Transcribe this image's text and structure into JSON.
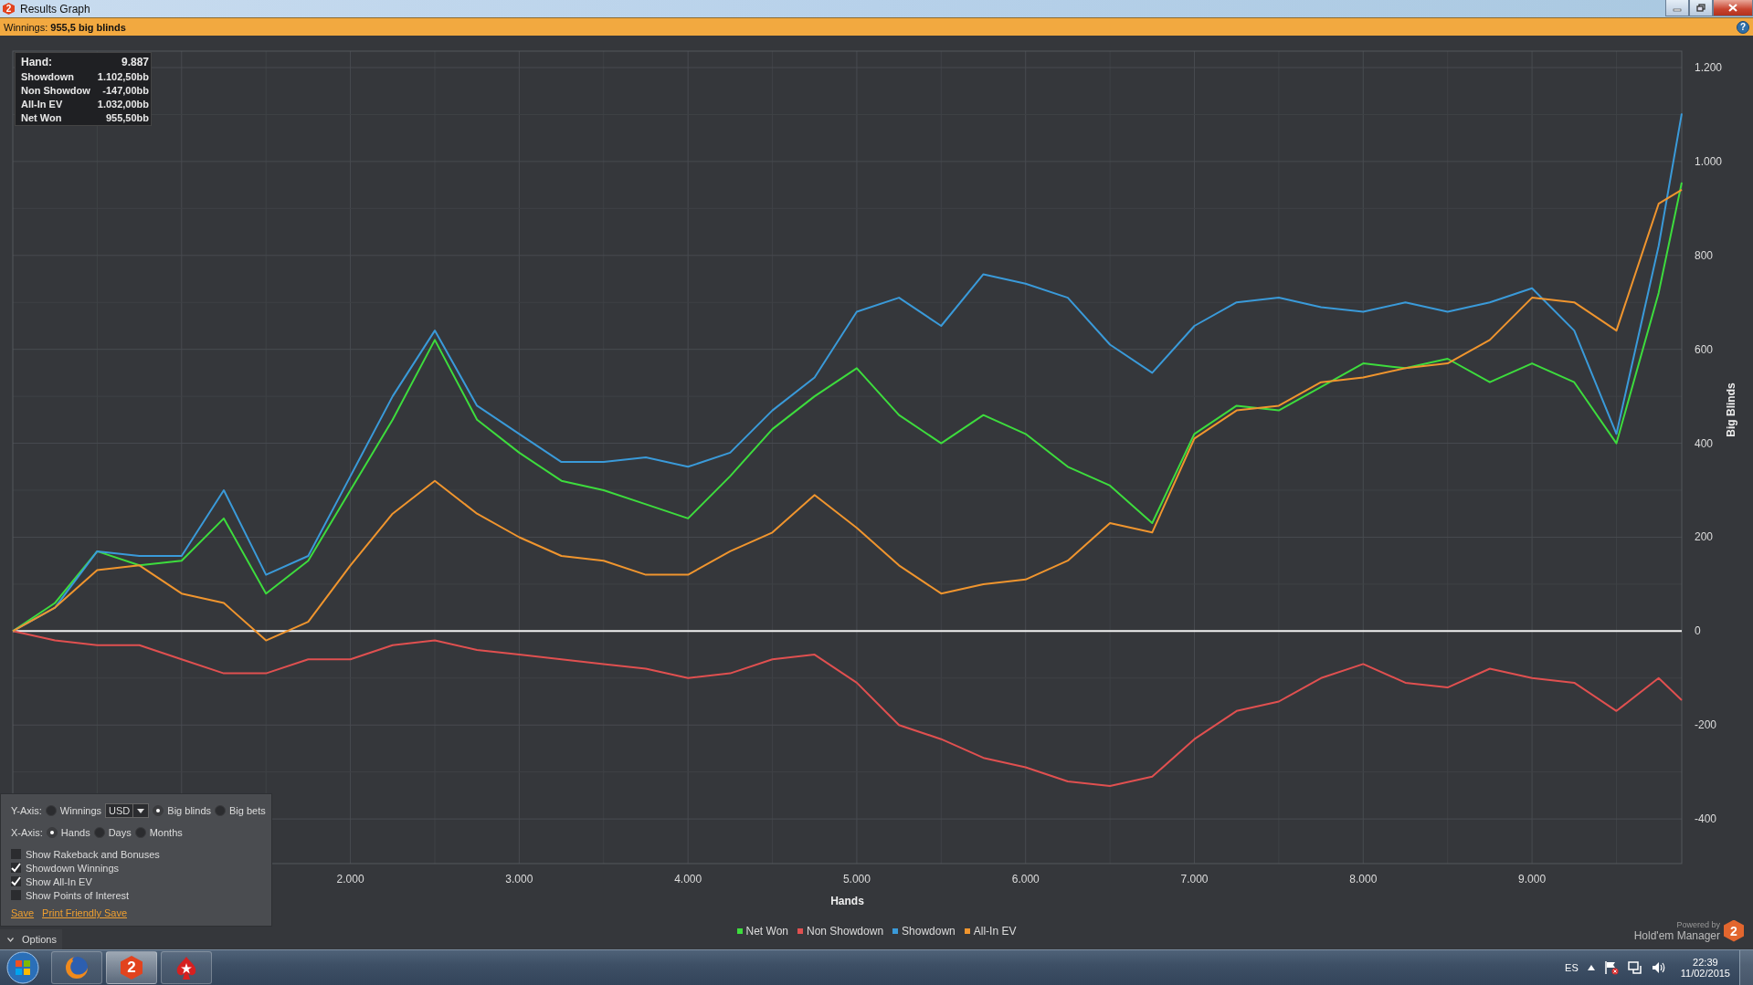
{
  "window": {
    "title": "Results Graph",
    "logo": "2"
  },
  "summary_bar": {
    "text": "Winnings: **955,5 big blinds**",
    "help": "?"
  },
  "stats_box": [
    {
      "label": "Hand:",
      "value": "9.887"
    },
    {
      "label": "Showdown",
      "value": "1.102,50bb"
    },
    {
      "label": "Non Showdow",
      "value": "-147,00bb"
    },
    {
      "label": "All-In EV",
      "value": "1.032,00bb"
    },
    {
      "label": "Net Won",
      "value": "955,50bb"
    }
  ],
  "chart_data": {
    "type": "line",
    "grid": true,
    "xlabel": "Hands",
    "ylabel": "Big Blinds",
    "xlim": [
      0,
      9887
    ],
    "ylim": [
      -495,
      1235
    ],
    "x": [
      0,
      250,
      500,
      750,
      1000,
      1250,
      1500,
      1750,
      2000,
      2250,
      2500,
      2750,
      3000,
      3250,
      3500,
      3750,
      4000,
      4250,
      4500,
      4750,
      5000,
      5250,
      5500,
      5750,
      6000,
      6250,
      6500,
      6750,
      7000,
      7250,
      7500,
      7750,
      8000,
      8250,
      8500,
      8750,
      9000,
      9250,
      9500,
      9750,
      9887
    ],
    "xticks": [
      {
        "value": 2000,
        "label": "2.000"
      },
      {
        "value": 3000,
        "label": "3.000"
      },
      {
        "value": 4000,
        "label": "4.000"
      },
      {
        "value": 5000,
        "label": "5.000"
      },
      {
        "value": 6000,
        "label": "6.000"
      },
      {
        "value": 7000,
        "label": "7.000"
      },
      {
        "value": 8000,
        "label": "8.000"
      },
      {
        "value": 9000,
        "label": "9.000"
      }
    ],
    "yticks": [
      {
        "value": -400,
        "label": "-400"
      },
      {
        "value": -200,
        "label": "-200"
      },
      {
        "value": 0,
        "label": "0"
      },
      {
        "value": 200,
        "label": "200"
      },
      {
        "value": 400,
        "label": "400"
      },
      {
        "value": 600,
        "label": "600"
      },
      {
        "value": 800,
        "label": "800"
      },
      {
        "value": 1000,
        "label": "1.000"
      },
      {
        "value": 1200,
        "label": "1.200"
      }
    ],
    "series": [
      {
        "name": "Net Won",
        "color": "#3ddc3d",
        "values": [
          0,
          60,
          170,
          140,
          150,
          240,
          80,
          150,
          300,
          450,
          620,
          450,
          380,
          320,
          300,
          270,
          240,
          330,
          430,
          500,
          560,
          460,
          400,
          460,
          420,
          350,
          310,
          230,
          420,
          480,
          470,
          520,
          570,
          560,
          580,
          530,
          570,
          530,
          400,
          720,
          955
        ]
      },
      {
        "name": "Non Showdown",
        "color": "#e05050",
        "values": [
          0,
          -20,
          -30,
          -30,
          -60,
          -90,
          -90,
          -60,
          -60,
          -30,
          -20,
          -40,
          -50,
          -60,
          -70,
          -80,
          -100,
          -90,
          -60,
          -50,
          -110,
          -200,
          -230,
          -270,
          -290,
          -320,
          -330,
          -310,
          -230,
          -170,
          -150,
          -100,
          -70,
          -110,
          -120,
          -80,
          -100,
          -110,
          -170,
          -100,
          -147
        ]
      },
      {
        "name": "Showdown",
        "color": "#3a9ad9",
        "values": [
          0,
          50,
          170,
          160,
          160,
          300,
          120,
          160,
          330,
          500,
          640,
          480,
          420,
          360,
          360,
          370,
          350,
          380,
          470,
          540,
          680,
          710,
          650,
          760,
          740,
          710,
          610,
          550,
          650,
          700,
          710,
          690,
          680,
          700,
          680,
          700,
          730,
          640,
          420,
          820,
          1102
        ]
      },
      {
        "name": "All-In EV",
        "color": "#f0952e",
        "values": [
          0,
          50,
          130,
          140,
          80,
          60,
          -20,
          20,
          140,
          250,
          320,
          250,
          200,
          160,
          150,
          120,
          120,
          170,
          210,
          290,
          220,
          140,
          80,
          100,
          110,
          150,
          230,
          210,
          410,
          470,
          480,
          530,
          540,
          560,
          570,
          620,
          710,
          700,
          640,
          910,
          940
        ]
      }
    ]
  },
  "options_panel": {
    "y_axis": {
      "label": "Y-Axis:",
      "items": [
        {
          "kind": "radio",
          "label": "Winnings",
          "selected": false
        },
        {
          "kind": "dropdown",
          "value": "USD"
        },
        {
          "kind": "radio",
          "label": "Big blinds",
          "selected": true
        },
        {
          "kind": "radio",
          "label": "Big bets",
          "selected": false
        }
      ]
    },
    "x_axis": {
      "label": "X-Axis:",
      "items": [
        {
          "kind": "radio",
          "label": "Hands",
          "selected": true
        },
        {
          "kind": "radio",
          "label": "Days",
          "selected": false
        },
        {
          "kind": "radio",
          "label": "Months",
          "selected": false
        }
      ]
    },
    "checkboxes": [
      {
        "label": "Show Rakeback and Bonuses",
        "checked": false
      },
      {
        "label": "Showdown Winnings",
        "checked": true
      },
      {
        "label": "Show All-In EV",
        "checked": true
      },
      {
        "label": "Show Points of Interest",
        "checked": false
      }
    ],
    "links": [
      "Save",
      "Print Friendly Save"
    ]
  },
  "options_toggle": {
    "label": "Options",
    "expanded": true
  },
  "branding": {
    "caption": "Powered by",
    "product": "Hold'em Manager",
    "logo": "2"
  },
  "taskbar": {
    "apps": [
      {
        "kind": "browser",
        "active": false
      },
      {
        "kind": "hm2",
        "logo": "2",
        "active": true
      },
      {
        "kind": "poker",
        "active": false
      }
    ],
    "language": "ES",
    "time": "22:39",
    "date": "11/02/2015"
  }
}
